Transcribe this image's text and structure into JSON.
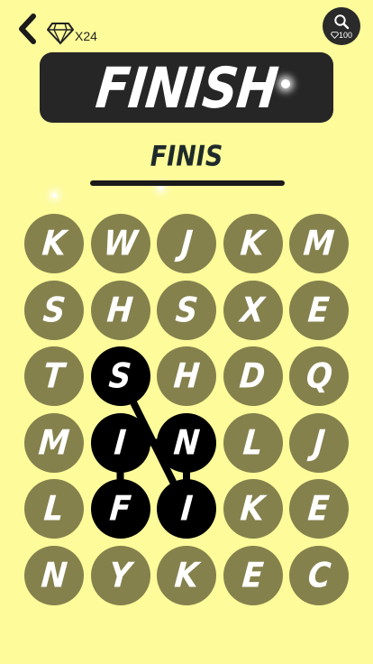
{
  "header": {
    "gem_count": "X24",
    "hint_cost": "100"
  },
  "target_word": "FINISH",
  "current_word": "FINIS",
  "grid": {
    "rows": [
      [
        "K",
        "W",
        "J",
        "K",
        "M"
      ],
      [
        "S",
        "H",
        "S",
        "X",
        "E"
      ],
      [
        "T",
        "S",
        "H",
        "D",
        "Q"
      ],
      [
        "M",
        "I",
        "N",
        "L",
        "J"
      ],
      [
        "L",
        "F",
        "I",
        "K",
        "E"
      ],
      [
        "N",
        "Y",
        "K",
        "E",
        "C"
      ]
    ],
    "selected_path": [
      [
        4,
        1
      ],
      [
        3,
        1
      ],
      [
        3,
        2
      ],
      [
        4,
        2
      ],
      [
        2,
        1
      ]
    ]
  },
  "colors": {
    "background": "#fdfb9a",
    "tile": "#85814d",
    "tile_selected": "#000000",
    "banner": "#262626"
  }
}
